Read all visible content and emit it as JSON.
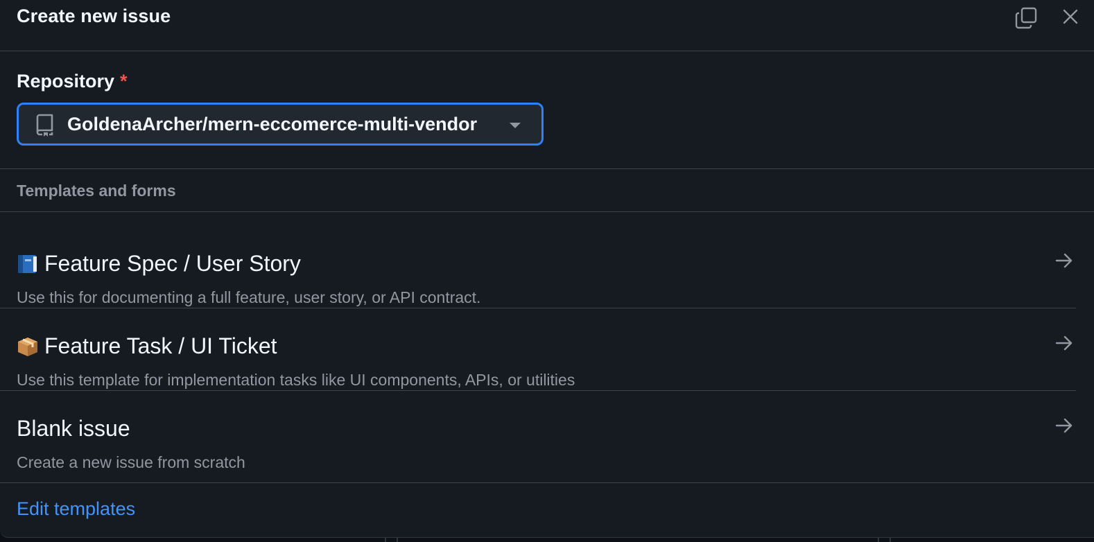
{
  "dialog": {
    "title": "Create new issue",
    "header_icons": [
      "copy-icon",
      "close-icon"
    ]
  },
  "repository": {
    "label": "Repository",
    "required_marker": "*",
    "selected": "GoldenaArcher/mern-eccomerce-multi-vendor",
    "icon": "repo-icon"
  },
  "templates": {
    "section_label": "Templates and forms",
    "items": [
      {
        "emoji": "blue-book-icon",
        "title": "Feature Spec / User Story",
        "description": "Use this for documenting a full feature, user story, or API contract."
      },
      {
        "emoji": "package-icon",
        "title": "Feature Task / UI Ticket",
        "description": "Use this template for implementation tasks like UI components, APIs, or utilities"
      },
      {
        "emoji": "",
        "title": "Blank issue",
        "description": "Create a new issue from scratch"
      }
    ]
  },
  "footer": {
    "edit_link": "Edit templates"
  },
  "colors": {
    "background": "#161b22",
    "accent_border": "#2f81f7",
    "link": "#4493f8",
    "required": "#f85149",
    "muted_text": "#9198a1"
  }
}
